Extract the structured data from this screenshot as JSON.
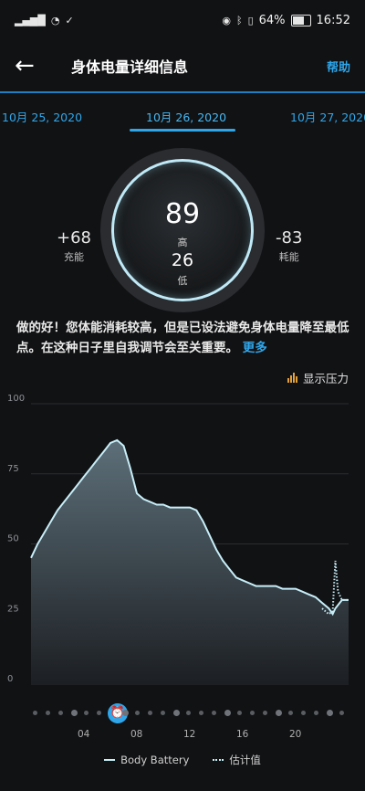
{
  "status_bar": {
    "time": "16:52",
    "battery": "64%"
  },
  "header": {
    "title": "身体电量详细信息",
    "help": "帮助"
  },
  "dates": {
    "prev": "10月 25, 2020",
    "current": "10月 26, 2020",
    "next": "10月 27, 2020"
  },
  "summary": {
    "high_value": "89",
    "high_label": "高",
    "low_value": "26",
    "low_label": "低",
    "charged_value": "+68",
    "charged_label": "充能",
    "drained_value": "-83",
    "drained_label": "耗能"
  },
  "message": {
    "text": "做的好！您体能消耗较高，但是已设法避免身体电量降至最低点。在这种日子里自我调节会至关重要。",
    "more": "更多"
  },
  "stress_toggle": "显示压力",
  "chart_data": {
    "type": "area",
    "ylim": [
      0,
      100
    ],
    "yticks": [
      "0",
      "25",
      "50",
      "75",
      "100"
    ],
    "xticks": [
      "04",
      "08",
      "12",
      "16",
      "20"
    ],
    "series": [
      {
        "name": "Body Battery",
        "x": [
          0,
          0.5,
          1,
          1.5,
          2,
          2.5,
          3,
          3.5,
          4,
          4.5,
          5,
          5.5,
          6,
          6.5,
          7,
          7.5,
          8,
          8.5,
          9,
          9.5,
          10,
          10.5,
          11,
          11.5,
          12,
          12.5,
          13,
          13.5,
          14,
          14.5,
          15,
          15.5,
          16,
          16.5,
          17,
          17.5,
          18,
          18.5,
          19,
          19.5,
          20,
          20.5,
          21,
          21.5,
          22,
          22.5,
          22.8,
          23,
          23.5,
          24
        ],
        "values": [
          45,
          50,
          54,
          58,
          62,
          65,
          68,
          71,
          74,
          77,
          80,
          83,
          86,
          87,
          85,
          77,
          68,
          66,
          65,
          64,
          64,
          63,
          63,
          63,
          63,
          62,
          58,
          53,
          48,
          44,
          41,
          38,
          37,
          36,
          35,
          35,
          35,
          35,
          34,
          34,
          34,
          33,
          32,
          31,
          29,
          27,
          25,
          27,
          30,
          30
        ]
      },
      {
        "name": "估计值",
        "x": [
          22,
          22.5,
          22.8,
          23,
          23.2,
          23.5,
          24
        ],
        "values": [
          27,
          25,
          26,
          44,
          33,
          30,
          30
        ]
      }
    ]
  },
  "legend": {
    "solid": "Body Battery",
    "dotted": "估计值"
  },
  "colors": {
    "accent": "#2fa6ea",
    "line": "#c7eef8",
    "stress": "#e3a13a"
  }
}
